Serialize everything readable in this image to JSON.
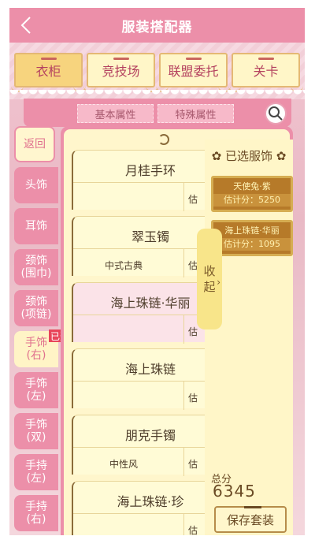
{
  "header": {
    "title": "服装搭配器"
  },
  "top_tabs": [
    {
      "label": "衣柜",
      "active": true
    },
    {
      "label": "竞技场",
      "active": false
    },
    {
      "label": "联盟委托",
      "active": false
    },
    {
      "label": "关卡",
      "active": false
    }
  ],
  "sub_tabs": [
    {
      "label": "基本属性"
    },
    {
      "label": "特殊属性"
    }
  ],
  "categories": [
    {
      "label": "返回"
    },
    {
      "label": "头饰"
    },
    {
      "label": "耳饰"
    },
    {
      "label": "颈饰\n(围巾)"
    },
    {
      "label": "颈饰\n(项链)"
    },
    {
      "label": "手饰\n(右)"
    },
    {
      "label": "手饰\n(左)"
    },
    {
      "label": "手饰\n(双)"
    },
    {
      "label": "手持\n(左)"
    },
    {
      "label": "手持\n(右)"
    }
  ],
  "selected_tag": "已选",
  "items": [
    {
      "name": "月桂手环",
      "tag": "",
      "est": "估"
    },
    {
      "name": "翠玉镯",
      "tag": "中式古典",
      "est": "估"
    },
    {
      "name": "海上珠链·华丽",
      "tag": "",
      "est": "估"
    },
    {
      "name": "海上珠链",
      "tag": "",
      "est": "估"
    },
    {
      "name": "朋克手镯",
      "tag": "中性风",
      "est": "估"
    },
    {
      "name": "海上珠链·珍",
      "tag": "",
      "est": "估"
    }
  ],
  "collapse": {
    "c1": "收",
    "c2": "起"
  },
  "selected_panel": {
    "title": "已选服饰",
    "items": [
      {
        "name": "天使兔·紫",
        "score": "估计分：5250"
      },
      {
        "name": "海上珠链·华丽",
        "score": "估计分：1095"
      }
    ],
    "total_label": "总分",
    "total_value": "6345",
    "save_label": "保存套装"
  },
  "colors": {
    "header": "#ec8fa9",
    "panel": "#fff6cc",
    "accent": "#b67a29"
  },
  "icons": {
    "back": "chevron-left-icon",
    "search": "search-icon"
  }
}
